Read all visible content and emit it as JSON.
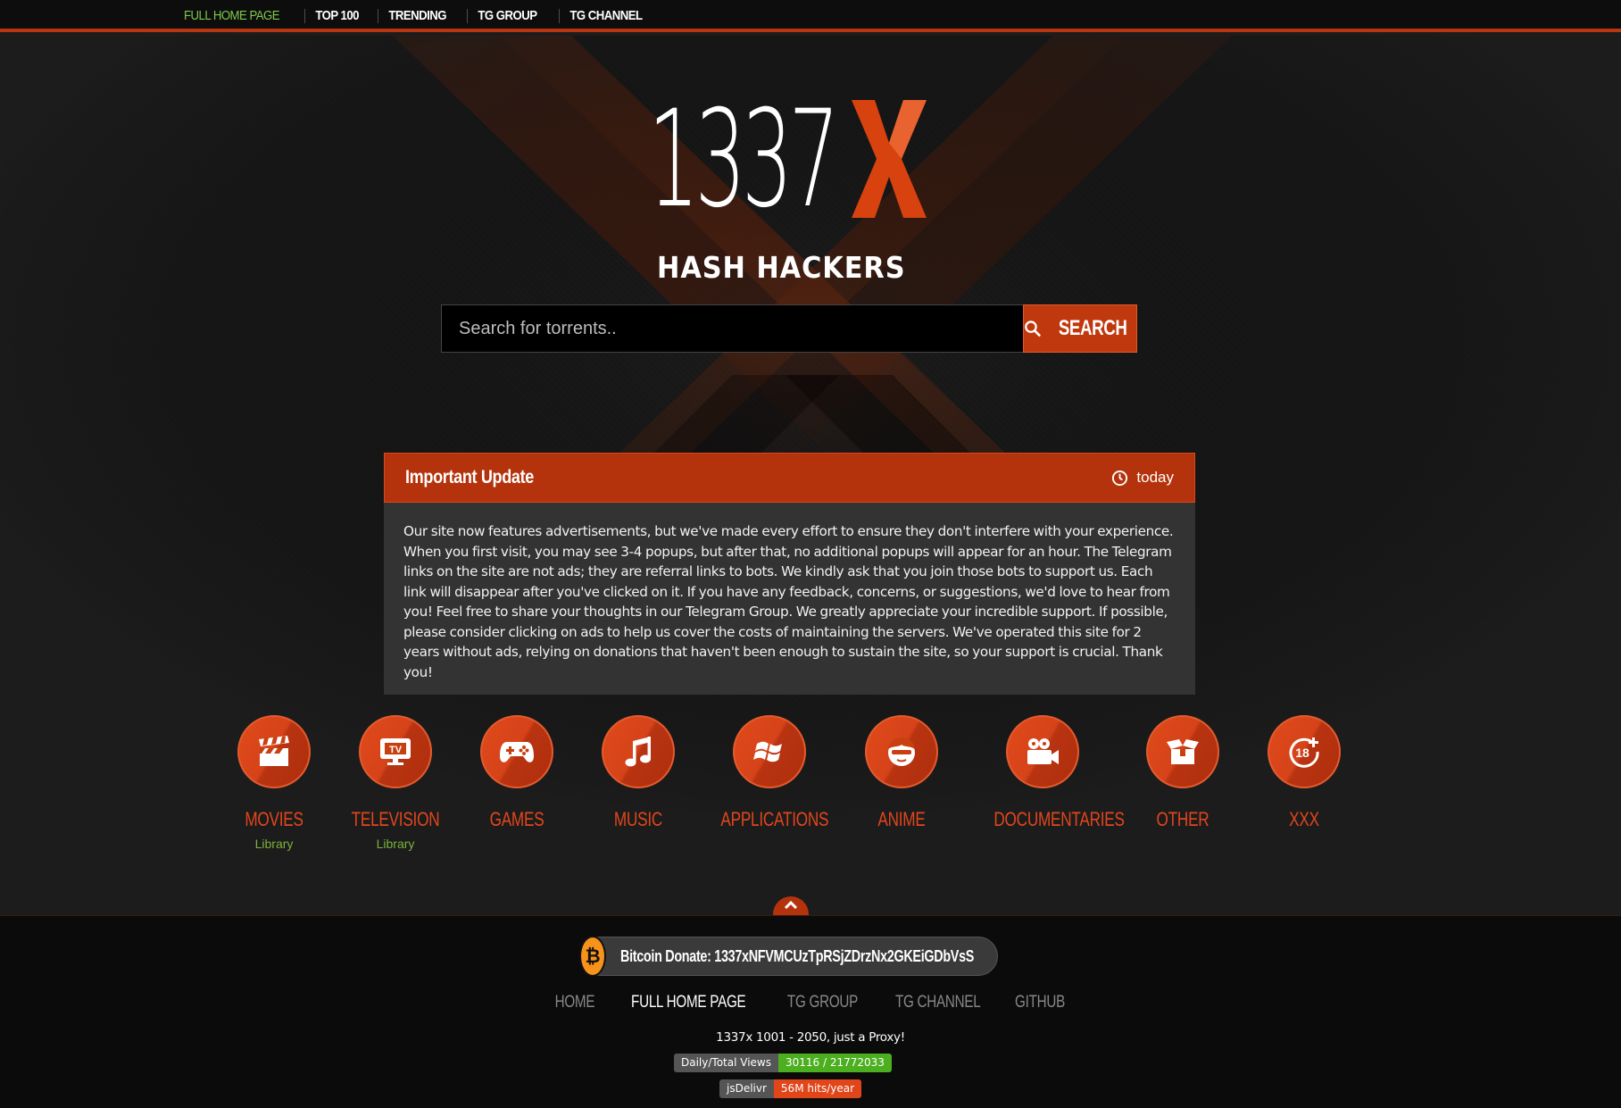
{
  "nav": {
    "items": [
      {
        "label": "FULL HOME PAGE",
        "active": true
      },
      {
        "label": "TOP 100",
        "active": false
      },
      {
        "label": "TRENDING",
        "active": false
      },
      {
        "label": "TG GROUP",
        "active": false
      },
      {
        "label": "TG CHANNEL",
        "active": false
      }
    ]
  },
  "logo": {
    "number": "1337",
    "letter": "X",
    "tagline": "HASH HACKERS"
  },
  "search": {
    "placeholder": "Search for torrents..",
    "button_label": "SEARCH"
  },
  "update": {
    "title": "Important Update",
    "time": "today",
    "body": "Our site now features advertisements, but we've made every effort to ensure they don't interfere with your experience. When you first visit, you may see 3-4 popups, but after that, no additional popups will appear for an hour. The Telegram links on the site are not ads; they are referral links to bots. We kindly ask that you join those bots to support us. Each link will disappear after you've clicked on it. If you have any feedback, concerns, or suggestions, we'd love to hear from you! Feel free to share your thoughts in our Telegram Group. We greatly appreciate your incredible support. If possible, please consider clicking on ads to help us cover the costs of maintaining the servers. We've operated this site for 2 years without ads, relying on donations that haven't been enough to sustain the site, so your support is crucial. Thank you!"
  },
  "categories": [
    {
      "name": "MOVIES",
      "sub": "Library",
      "icon": "clapperboard-icon"
    },
    {
      "name": "TELEVISION",
      "sub": "Library",
      "icon": "tv-icon"
    },
    {
      "name": "GAMES",
      "sub": "",
      "icon": "gamepad-icon"
    },
    {
      "name": "MUSIC",
      "sub": "",
      "icon": "music-note-icon"
    },
    {
      "name": "APPLICATIONS",
      "sub": "",
      "icon": "windows-icon"
    },
    {
      "name": "ANIME",
      "sub": "",
      "icon": "anime-face-icon"
    },
    {
      "name": "DOCUMENTARIES",
      "sub": "",
      "icon": "video-camera-icon"
    },
    {
      "name": "OTHER",
      "sub": "",
      "icon": "open-box-icon"
    },
    {
      "name": "XXX",
      "sub": "",
      "icon": "eighteen-plus-icon"
    }
  ],
  "footer": {
    "bitcoin": "Bitcoin Donate: 1337xNFVMCUzTpRSjZDrzNx2GKEiGDbVsS",
    "links": [
      {
        "label": "HOME",
        "active": false
      },
      {
        "label": "FULL HOME PAGE",
        "active": true
      },
      {
        "label": "TG GROUP",
        "active": false
      },
      {
        "label": "TG CHANNEL",
        "active": false
      },
      {
        "label": "GITHUB",
        "active": false
      }
    ],
    "tagline": "1337x 1001 - 2050, just a Proxy!",
    "views_badge": {
      "label": "Daily/Total Views",
      "value": "30116 / 21772033",
      "color": "#4caf1f"
    },
    "cdn_badge": {
      "label": "jsDelivr",
      "value": "56M hits/year",
      "color": "#e0461a"
    }
  },
  "colors": {
    "accent": "#c0380e",
    "nav_active": "#7ec84a",
    "library_green": "#7ab239"
  }
}
